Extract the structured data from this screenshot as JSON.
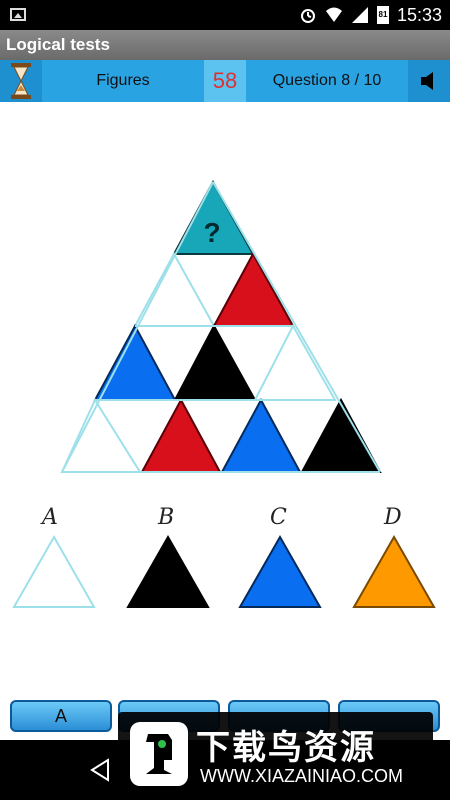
{
  "status_bar": {
    "time": "15:33",
    "battery": "81"
  },
  "app": {
    "title": "Logical tests"
  },
  "info_bar": {
    "category": "Figures",
    "timer": "58",
    "question": "Question 8 / 10"
  },
  "puzzle": {
    "unknown_mark": "?"
  },
  "options": [
    {
      "label": "A",
      "color": "#ffffff"
    },
    {
      "label": "B",
      "color": "#000000"
    },
    {
      "label": "C",
      "color": "#0a6ef0"
    },
    {
      "label": "D",
      "color": "#ff9900"
    }
  ],
  "answer_buttons": [
    "A",
    "",
    "",
    ""
  ],
  "watermark": {
    "title": "下载鸟资源",
    "url": "WWW.XIAZAINIAO.COM"
  },
  "colors": {
    "teal": "#17a7b8",
    "red": "#d7101c",
    "blue": "#0a6ef0",
    "black": "#000000",
    "orange": "#ff9900",
    "accent": "#2aa3e3"
  }
}
